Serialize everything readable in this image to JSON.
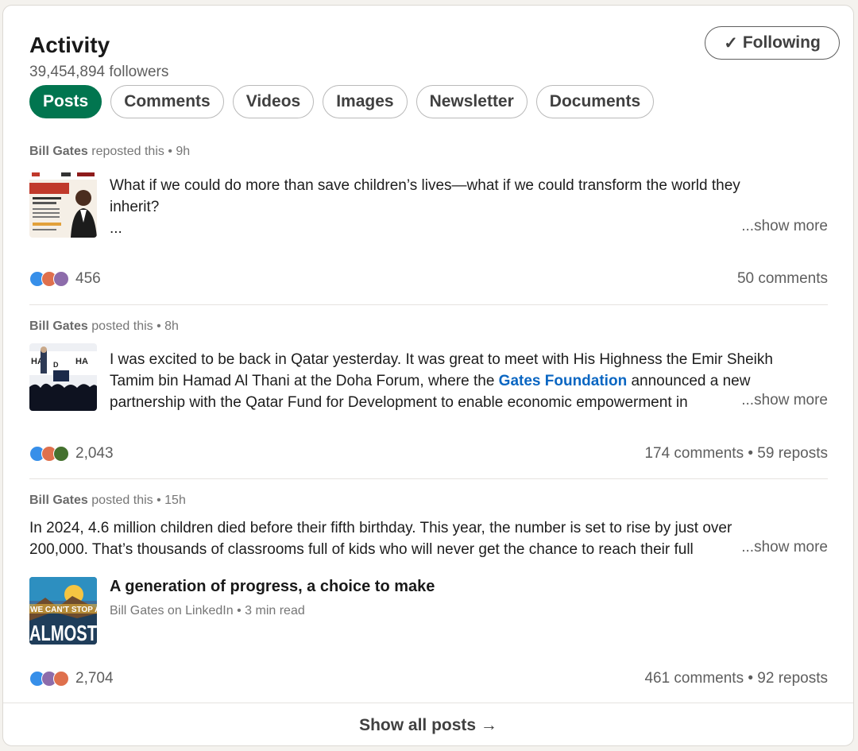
{
  "header": {
    "title": "Activity",
    "followers": "39,454,894 followers",
    "follow_button": "Following",
    "follow_icon": "✓"
  },
  "tabs": [
    {
      "label": "Posts",
      "active": true
    },
    {
      "label": "Comments",
      "active": false
    },
    {
      "label": "Videos",
      "active": false
    },
    {
      "label": "Images",
      "active": false
    },
    {
      "label": "Newsletter",
      "active": false
    },
    {
      "label": "Documents",
      "active": false
    }
  ],
  "posts": [
    {
      "author": "Bill Gates",
      "action": "reposted this • 9h",
      "text_line1": "What if we could do more than save children’s lives—what if we could transform the world they",
      "text_line2": "inherit?",
      "text_line3": "...",
      "show_more": "...show more",
      "reaction_count": "456",
      "stats": "50 comments"
    },
    {
      "author": "Bill Gates",
      "action": "posted this • 8h",
      "text_line1": "I was excited to be back in Qatar yesterday. It was great to meet with His Highness the Emir Sheikh",
      "text_line2_pre": "Tamim bin Hamad Al Thani at the Doha Forum, where the ",
      "text_line2_link": "Gates Foundation",
      "text_line2_post": " announced a new",
      "text_line3": "partnership with the Qatar Fund for Development to enable economic empowerment in",
      "show_more": "...show more",
      "reaction_count": "2,043",
      "stats": "174 comments • 59 reposts"
    },
    {
      "author": "Bill Gates",
      "action": "posted this • 15h",
      "text_line1": "In 2024, 4.6 million children died before their fifth birthday. This year, the number is set to rise by just over",
      "text_line2": "200,000. That’s thousands of classrooms full of kids who will never get the chance to reach their full",
      "show_more": "...show more",
      "article_title": "A generation of progress, a choice to make",
      "article_sub": "Bill Gates on LinkedIn • 3 min read",
      "thumb_text_top": "WE CAN'T STOP AT",
      "thumb_text_bottom": "ALMOST",
      "reaction_count": "2,704",
      "stats": "461 comments • 92 reposts"
    }
  ],
  "footer": {
    "label": "Show all posts →"
  },
  "colors": {
    "accent_green": "#01754f",
    "link_blue": "#0a66c2"
  }
}
